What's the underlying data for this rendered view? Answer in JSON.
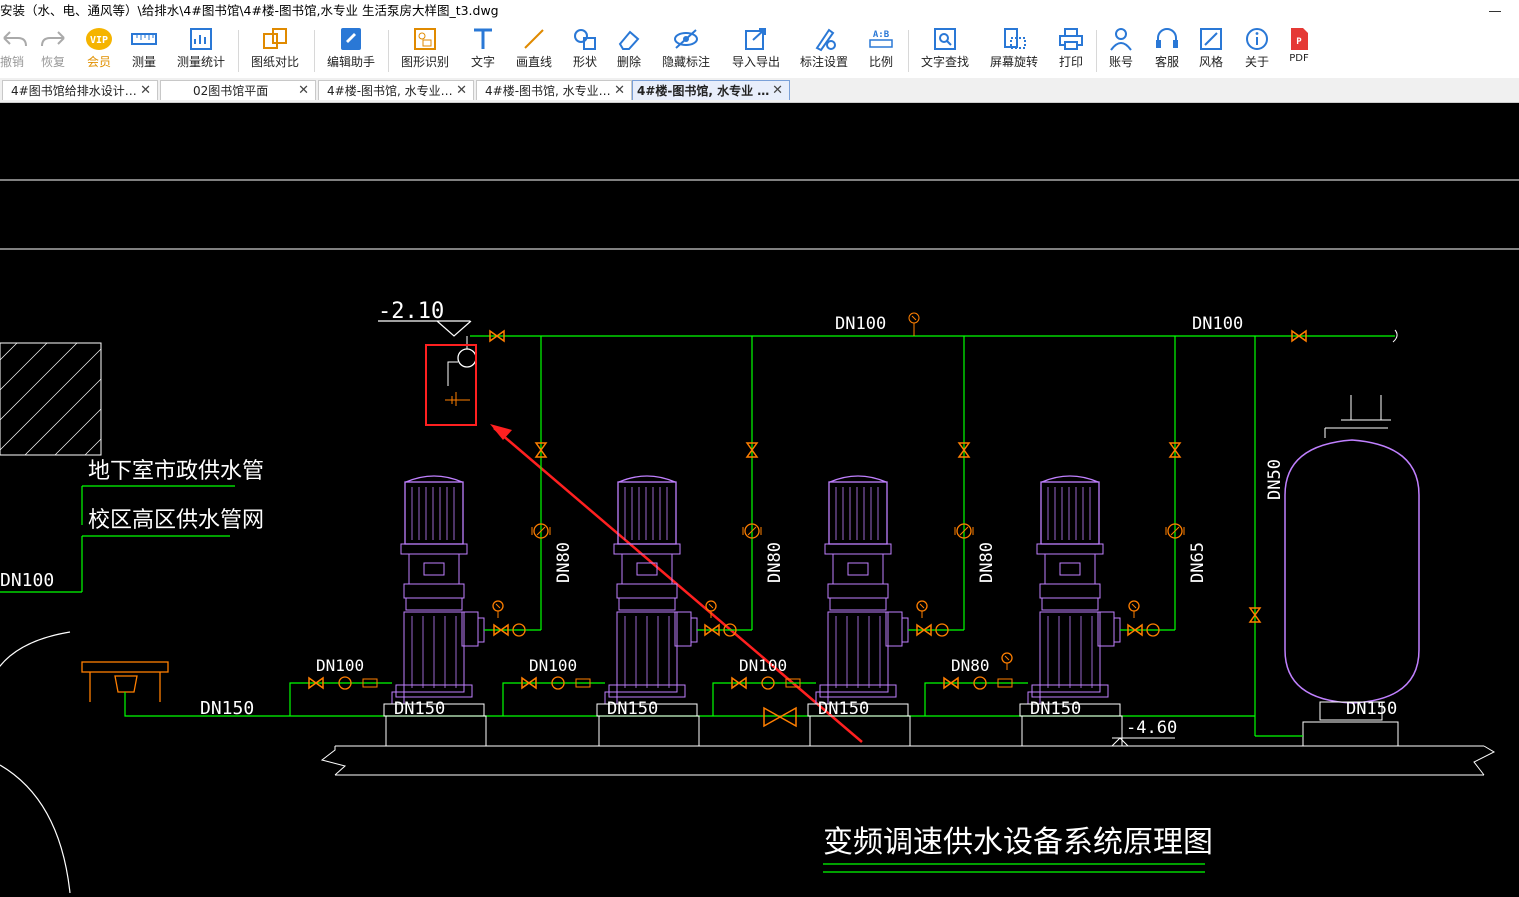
{
  "window": {
    "title": "安装（水、电、通风等）\\给排水\\4#图书馆\\4#楼-图书馆,水专业 生活泵房大样图_t3.dwg"
  },
  "toolbar": {
    "items": [
      {
        "label": "撤销",
        "icon": "undo-icon"
      },
      {
        "label": "恢复",
        "icon": "redo-icon"
      },
      {
        "label": "会员",
        "icon": "vip-icon"
      },
      {
        "label": "测量",
        "icon": "measure-icon"
      },
      {
        "label": "测量统计",
        "icon": "measure-stats-icon"
      },
      {
        "label": "图纸对比",
        "icon": "compare-icon"
      },
      {
        "label": "编辑助手",
        "icon": "edit-assistant-icon"
      },
      {
        "label": "图形识别",
        "icon": "shape-recognition-icon"
      },
      {
        "label": "文字",
        "icon": "text-icon"
      },
      {
        "label": "画直线",
        "icon": "line-icon"
      },
      {
        "label": "形状",
        "icon": "shape-icon"
      },
      {
        "label": "删除",
        "icon": "eraser-icon"
      },
      {
        "label": "隐藏标注",
        "icon": "hide-annotation-icon"
      },
      {
        "label": "导入导出",
        "icon": "import-export-icon"
      },
      {
        "label": "标注设置",
        "icon": "annotation-settings-icon"
      },
      {
        "label": "比例",
        "icon": "scale-icon"
      },
      {
        "label": "文字查找",
        "icon": "text-search-icon"
      },
      {
        "label": "屏幕旋转",
        "icon": "rotate-screen-icon"
      },
      {
        "label": "打印",
        "icon": "print-icon"
      },
      {
        "label": "账号",
        "icon": "account-icon"
      },
      {
        "label": "客服",
        "icon": "headset-icon"
      },
      {
        "label": "风格",
        "icon": "style-icon"
      },
      {
        "label": "关于",
        "icon": "info-icon"
      },
      {
        "label": "PDF",
        "icon": "pdf-icon"
      }
    ]
  },
  "tabs": [
    {
      "label": "4#图书馆给排水设计…"
    },
    {
      "label": "02图书馆平面"
    },
    {
      "label": "4#楼-图书馆, 水专业…"
    },
    {
      "label": "4#楼-图书馆, 水专业…"
    },
    {
      "label": "4#楼-图书馆, 水专业 …"
    }
  ],
  "tab_close_glyph": "✕",
  "drawing": {
    "elevation_top": "-2.10",
    "elevation_bottom": "-4.60",
    "label_basement_supply": "地下室市政供水管",
    "label_campus_network": "校区高区供水管网",
    "dn100_left": "DN100",
    "dn150_main": "DN150",
    "dn100_top_1": "DN100",
    "dn100_top_2": "DN100",
    "riser_labels": [
      "DN80",
      "DN80",
      "DN80",
      "DN65"
    ],
    "tank_riser": "DN50",
    "suction_labels": [
      "DN100",
      "DN100",
      "DN100",
      "DN80"
    ],
    "base_labels": [
      "DN150",
      "DN150",
      "DN150",
      "DN150"
    ],
    "title": "变频调速供水设备系统原理图",
    "colors": {
      "background": "#000000",
      "pipe": "#00ff00",
      "valve": "#ff7f00",
      "pump": "#c080ff",
      "annotation": "#ff2020",
      "white": "#ffffff"
    }
  }
}
